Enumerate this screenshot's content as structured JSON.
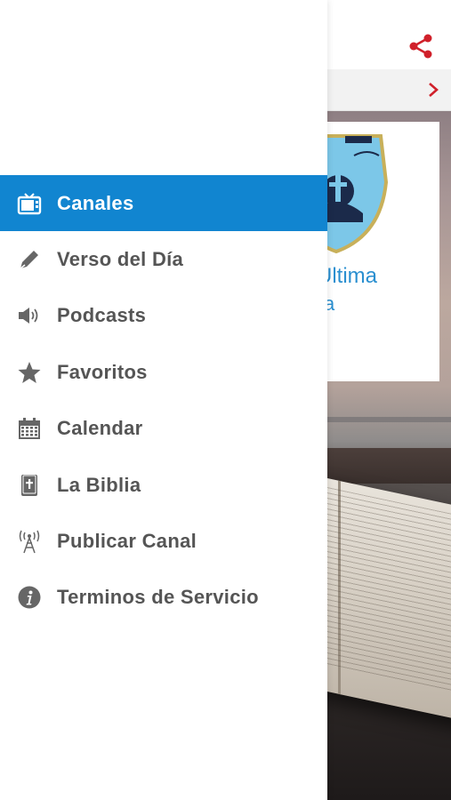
{
  "menu": {
    "items": [
      {
        "label": "Canales",
        "icon": "tv-icon",
        "active": true
      },
      {
        "label": "Verso del Día",
        "icon": "pen-icon",
        "active": false
      },
      {
        "label": "Podcasts",
        "icon": "speaker-icon",
        "active": false
      },
      {
        "label": "Favoritos",
        "icon": "star-icon",
        "active": false
      },
      {
        "label": "Calendar",
        "icon": "calendar-icon",
        "active": false
      },
      {
        "label": "La Biblia",
        "icon": "bible-icon",
        "active": false
      },
      {
        "label": "Publicar Canal",
        "icon": "antenna-icon",
        "active": false
      },
      {
        "label": "Terminos de Servicio",
        "icon": "info-icon",
        "active": false
      }
    ]
  },
  "background": {
    "card_title_line1": "Última",
    "card_title_line2": "a"
  },
  "colors": {
    "accent": "#1185d0",
    "share": "#d0202a",
    "menu_text": "#555555"
  }
}
